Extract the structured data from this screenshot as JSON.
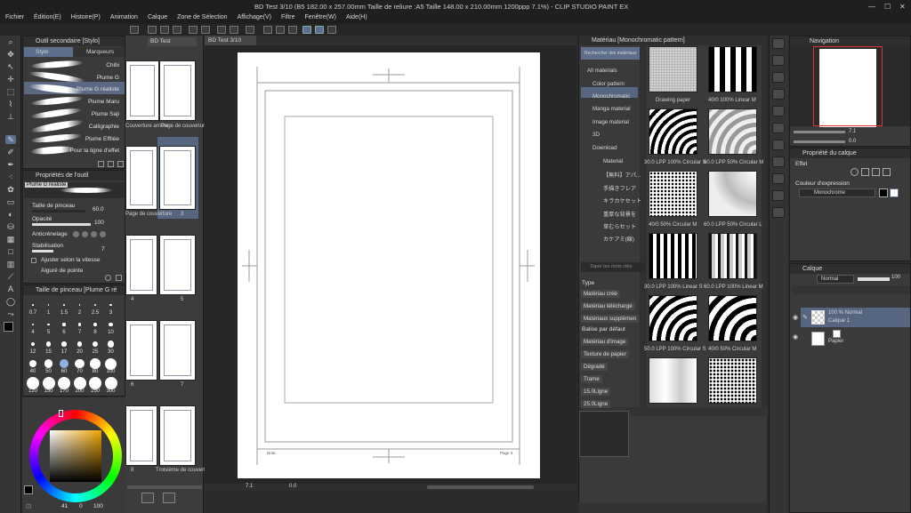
{
  "window": {
    "title": "BD Test 3/10 (B5 182.00 x 257.00mm Taille de reliure :A5 Taille 148.00 x 210.00mm 1200ppp 7.1%) - CLIP STUDIO PAINT EX"
  },
  "menu": [
    "Fichier",
    "Édition(E)",
    "Histoire(P)",
    "Animation",
    "Calque",
    "Zone de Sélection",
    "Affichage(V)",
    "Filtre",
    "Fenêtre(W)",
    "Aide(H)"
  ],
  "subtool_panel": {
    "title": "Outil secondaire [Stylo]",
    "tabs": [
      "Stylo",
      "Marqueurs"
    ],
    "items": [
      "Chibi",
      "Plume G",
      "Plume G réaliste",
      "Plume Maru",
      "Plume Saji",
      "Calligraphie",
      "Plume Effilée",
      "Pour la ligne d'effet"
    ]
  },
  "tool_property": {
    "title": "Propriétés de l'outil",
    "preset_name": "Plume G réaliste",
    "brush_size_label": "Taille de pinceau",
    "brush_size_value": "60.0",
    "opacity_label": "Opacité",
    "opacity_value": "100",
    "antialias_label": "Anticrénelage",
    "stabilization_label": "Stabilisation",
    "stabilization_value": "7",
    "speed_label": "Ajuster selon la vitesse",
    "sharp_label": "Aiguré de pointe"
  },
  "brush_size_panel": {
    "title": "Taille de pinceau [Plume G ré",
    "sizes": [
      "0.7",
      "1",
      "1.5",
      "2",
      "2.5",
      "3",
      "4",
      "5",
      "6",
      "7",
      "8",
      "10",
      "12",
      "15",
      "17",
      "20",
      "25",
      "30",
      "40",
      "50",
      "60",
      "70",
      "80",
      "100",
      "120",
      "150",
      "170",
      "200",
      "250",
      "300"
    ]
  },
  "color_wheel": {
    "h": "41",
    "s": "0",
    "v": "100"
  },
  "page_manager": {
    "tab": "BD Test",
    "labels": [
      "Couverture arrière",
      "Page de couverture",
      "Page de couverture",
      "3",
      "4",
      "5",
      "6",
      "7",
      "8",
      "Troisième de couverture"
    ]
  },
  "canvas": {
    "tab": "BD Test 3/10",
    "page_number": "Page 3",
    "corner_text": "Nota",
    "zoom": "7.1",
    "angle": "0.0"
  },
  "material_panel": {
    "title": "Matériau [Monochromatic pattern]",
    "search_button": "Rechercher des matériaux",
    "tree": [
      "All materials",
      "Color pattern",
      "Monochromatic",
      "Manga material",
      "Image material",
      "3D",
      "Download",
      "Material",
      "【無料】アパ...",
      "手描きフレア",
      "キラカケセット",
      "重厚な背景を",
      "草むらセット",
      "カケアミ(線)"
    ],
    "search_placeholder": "Taper les mots clés",
    "type_label": "Type",
    "type_tags": [
      "Matériau créé",
      "Matériau téléchargé",
      "Matériaux supplémen"
    ],
    "default_label": "Balise par défaut",
    "default_tags": [
      "Matériau d'image",
      "Texture de papier",
      "Dégradé",
      "Trame",
      "15.0Ligne",
      "25.0Ligne"
    ],
    "items": [
      "Drawing paper",
      "40/0 100% Linear M",
      "30.0 LPP 100% Circular S",
      "60.0 LPP 50% Circular M",
      "40/0 50% Circular M",
      "60.0 LPP 50% Circular L",
      "30.0 LPP 100% Linear S",
      "60.0 LPP 100% Linear M",
      "50.0 LPP 100% Circular S",
      "40/0 50% Circular M",
      "",
      ""
    ]
  },
  "navigation": {
    "title": "Navigation",
    "zoom": "7.1",
    "angle": "0.0"
  },
  "layer_property": {
    "title": "Propriété du calque",
    "effect_label": "Effet",
    "expression_label": "Couleur d'expression",
    "expression_value": "Monochrome"
  },
  "layers": {
    "title": "Calque",
    "blend_mode": "Normal",
    "opacity": "100",
    "items": [
      {
        "line1": "100 % Normal",
        "line2": "Calque 1"
      },
      {
        "line1": "",
        "line2": "Papier"
      }
    ]
  },
  "colors": {
    "accent": "#5d6f8c",
    "panel": "#3a3a3a",
    "bg": "#2b2b2b",
    "canvas": "#ffffff"
  }
}
